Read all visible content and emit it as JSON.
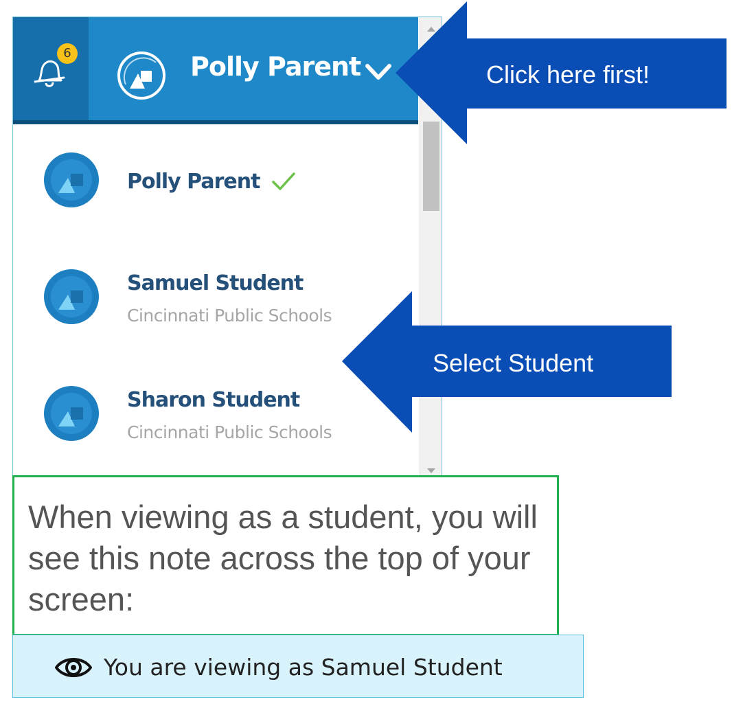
{
  "header": {
    "notification_count": "6",
    "current_user": "Polly Parent"
  },
  "accounts": [
    {
      "name": "Polly Parent",
      "school": ""
    },
    {
      "name": "Samuel Student",
      "school": "Cincinnati Public Schools"
    },
    {
      "name": "Sharon Student",
      "school": "Cincinnati Public Schools"
    }
  ],
  "callouts": {
    "click_first": "Click here first!",
    "select_student": "Select Student"
  },
  "note": {
    "text": "When viewing as a student, you will see this note across the top of your screen:"
  },
  "banner": {
    "text": "You are viewing as Samuel Student"
  },
  "icons": [
    "bell-icon",
    "avatar-icon",
    "chevron-down-icon",
    "checkmark-icon",
    "eye-icon"
  ],
  "colors": {
    "header_blue": "#1e88c9",
    "arrow_blue": "#0a4db5",
    "name_blue": "#24507a",
    "note_border": "#1fb04f",
    "banner_bg": "#d9f3fc"
  }
}
